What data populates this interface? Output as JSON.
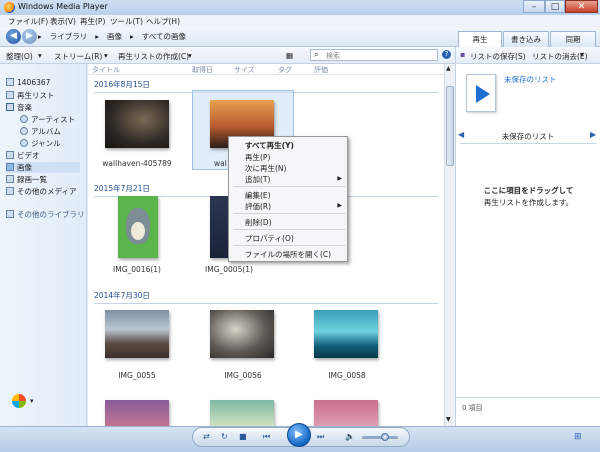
{
  "window": {
    "title": "Windows Media Player",
    "minimize": "–",
    "maximize": "□",
    "close": "✕"
  },
  "menu": [
    "ファイル(F)",
    "表示(V)",
    "再生(P)",
    "ツール(T)",
    "ヘルプ(H)"
  ],
  "breadcrumb": [
    "ライブラリ",
    "画像",
    "すべての画像"
  ],
  "tabs": {
    "play": "再生",
    "burn": "書き込み",
    "sync": "同期"
  },
  "toolbar": {
    "organize": "整理(O)",
    "stream": "ストリーム(R)",
    "create_playlist": "再生リストの作成(C)"
  },
  "search": {
    "placeholder": "検索"
  },
  "right_toolbar": {
    "save_list": "リストの保存(S)",
    "clear_list": "リストの消去(E)"
  },
  "nav": {
    "user": "1406367",
    "items": [
      {
        "label": "再生リスト",
        "indent": 1
      },
      {
        "label": "音楽",
        "indent": 1
      },
      {
        "label": "アーティスト",
        "indent": 2
      },
      {
        "label": "アルバム",
        "indent": 2
      },
      {
        "label": "ジャンル",
        "indent": 2
      },
      {
        "label": "ビデオ",
        "indent": 1
      },
      {
        "label": "画像",
        "indent": 1,
        "selected": true
      },
      {
        "label": "録画一覧",
        "indent": 1
      },
      {
        "label": "その他のメディア",
        "indent": 1
      }
    ],
    "other_libraries": "その他のライブラリ"
  },
  "columns": [
    "タイトル",
    "取得日",
    "サイズ",
    "タグ",
    "評価"
  ],
  "groups": [
    {
      "date": "2016年8月15日",
      "items": [
        {
          "caption": "wallhaven-405789"
        },
        {
          "caption": "wal"
        }
      ]
    },
    {
      "date": "2015年7月21日",
      "items": [
        {
          "caption": "IMG_0016(1)"
        },
        {
          "caption": "IMG_0005(1)"
        }
      ]
    },
    {
      "date": "2014年7月30日",
      "items": [
        {
          "caption": "IMG_0055"
        },
        {
          "caption": "IMG_0056"
        },
        {
          "caption": "IMG_0058"
        }
      ]
    }
  ],
  "context_menu": [
    "すべて再生(Y)",
    "再生(P)",
    "次に再生(N)",
    "追加(T)",
    "編集(E)",
    "評価(R)",
    "削除(D)",
    "プロパティ(O)",
    "ファイルの場所を開く(C)"
  ],
  "playlist": {
    "unsaved_link": "未保存のリスト",
    "unsaved_header": "未保存のリスト",
    "drag_hint_1": "ここに項目をドラッグして",
    "drag_hint_2": "再生リストを作成します。",
    "count": "0 項目"
  },
  "colors": {
    "accent": "#1e6fd0",
    "group_header": "#1f4f8f",
    "bg": "#dfe9f5"
  }
}
